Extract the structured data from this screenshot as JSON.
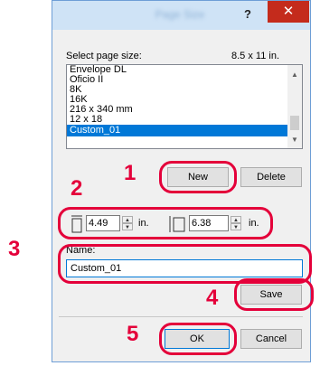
{
  "dialog": {
    "title": "Page Size",
    "help_label": "?",
    "close_label": "✕"
  },
  "page_size": {
    "label": "Select page size:",
    "current_size": "8.5 x 11 in.",
    "items": [
      "Envelope DL",
      "Oficio II",
      "8K",
      "16K",
      "216 x 340 mm",
      "12 x 18",
      "Custom_01"
    ],
    "selected_index": 6
  },
  "buttons": {
    "new_label": "New",
    "delete_label": "Delete",
    "save_label": "Save",
    "ok_label": "OK",
    "cancel_label": "Cancel"
  },
  "size": {
    "width_value": "4.49",
    "height_value": "6.38",
    "unit": "in."
  },
  "name": {
    "label": "Name:",
    "value": "Custom_01"
  },
  "steps": [
    "1",
    "2",
    "3",
    "4",
    "5"
  ],
  "colors": {
    "callout": "#e4003a",
    "selection": "#0078d7",
    "close": "#c42b1c"
  }
}
